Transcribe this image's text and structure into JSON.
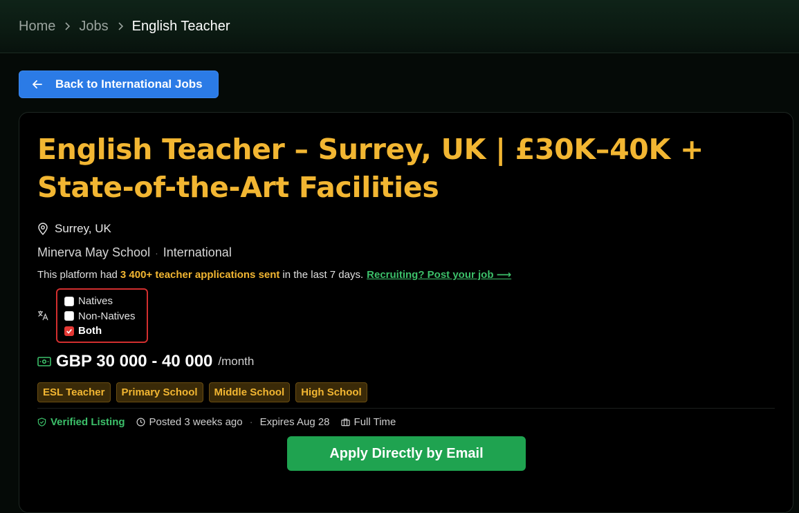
{
  "breadcrumb": {
    "home": "Home",
    "jobs": "Jobs",
    "current": "English Teacher"
  },
  "back_button": {
    "label": "Back to International Jobs"
  },
  "job": {
    "title": "English Teacher – Surrey, UK | £30K–40K + State-of-the-Art Facilities",
    "location": "Surrey, UK",
    "company": "Minerva May School",
    "category": "International",
    "stats": {
      "prefix": "This platform had",
      "highlight": "3 400+ teacher applications sent",
      "suffix": "in the last 7 days.",
      "link": "Recruiting? Post your job ⟶"
    },
    "language_options": [
      {
        "label": "Natives",
        "checked": false
      },
      {
        "label": "Non-Natives",
        "checked": false
      },
      {
        "label": "Both",
        "checked": true
      }
    ],
    "salary": {
      "amount": "GBP 30 000 - 40 000",
      "period": "/month"
    },
    "tags": [
      "ESL Teacher",
      "Primary School",
      "Middle School",
      "High School"
    ],
    "meta": {
      "verified": "Verified Listing",
      "posted": "Posted 3 weeks ago",
      "expires": "Expires Aug 28",
      "type": "Full Time"
    },
    "apply_label": "Apply Directly by Email"
  },
  "colors": {
    "accent_gold": "#f2b632",
    "primary_blue": "#2b7be6",
    "success_green": "#1fa350",
    "alert_red": "#d32f2f"
  }
}
